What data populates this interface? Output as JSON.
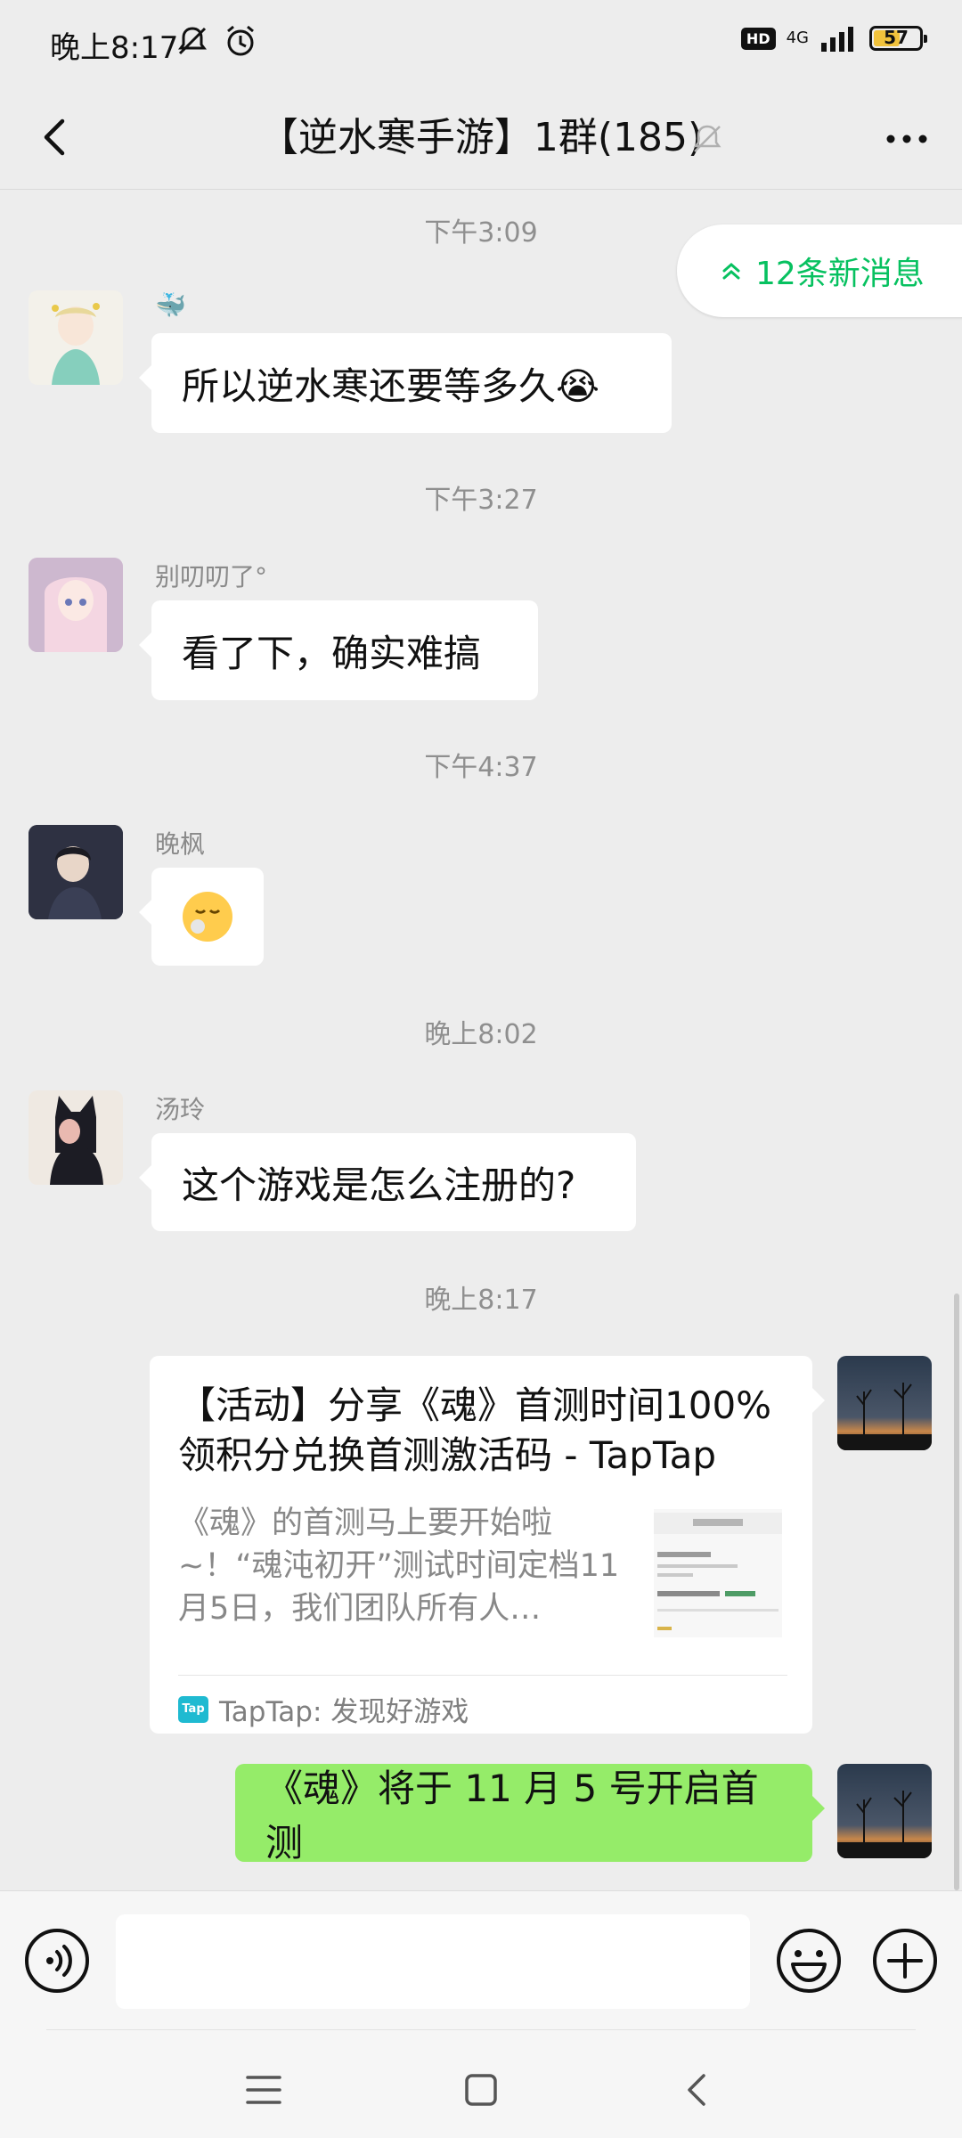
{
  "status_bar": {
    "time": "晚上8:17",
    "hd_label": "HD",
    "network": "4G",
    "battery": "57",
    "battery_level": 0.57
  },
  "header": {
    "title": "【逆水寒手游】1群(185)",
    "back_icon": "chevron-left-icon",
    "mute_icon": "bell-off-icon",
    "more_icon": "more-dots-icon"
  },
  "new_messages": {
    "label": "12条新消息",
    "icon": "double-chevron-up-icon"
  },
  "messages": [
    {
      "time": "下午3:09",
      "sender": "🐳",
      "text": "所以逆水寒还要等多久😭"
    },
    {
      "time": "下午3:27",
      "sender": "别叨叨了°",
      "text": "看了下，确实难搞"
    },
    {
      "time": "下午4:37",
      "sender": "晚枫",
      "text": "😮‍💨"
    },
    {
      "time": "晚上8:02",
      "sender": "汤玲",
      "text": "这个游戏是怎么注册的?"
    },
    {
      "time": "晚上8:17",
      "card": {
        "title": "【活动】分享《魂》首测时间100%领积分兑换首测激活码 - TapTap",
        "description": "《魂》的首测马上要开始啦~！“魂沌初开”测试时间定档11月5日，我们团队所有人…",
        "source": "TapTap: 发现好游戏",
        "logo_text": "Tap"
      }
    },
    {
      "text": "《魂》将于 11 月 5 号开启首测"
    }
  ],
  "input_bar": {
    "placeholder": "",
    "voice_icon": "voice-icon",
    "emoji_icon": "emoji-icon",
    "plus_icon": "plus-circle-icon"
  },
  "system_nav": {
    "menu_icon": "menu-icon",
    "home_icon": "home-icon",
    "back_icon": "back-icon"
  },
  "colors": {
    "accent": "#07c160",
    "self_bubble": "#95ec69",
    "background": "#ededed"
  }
}
